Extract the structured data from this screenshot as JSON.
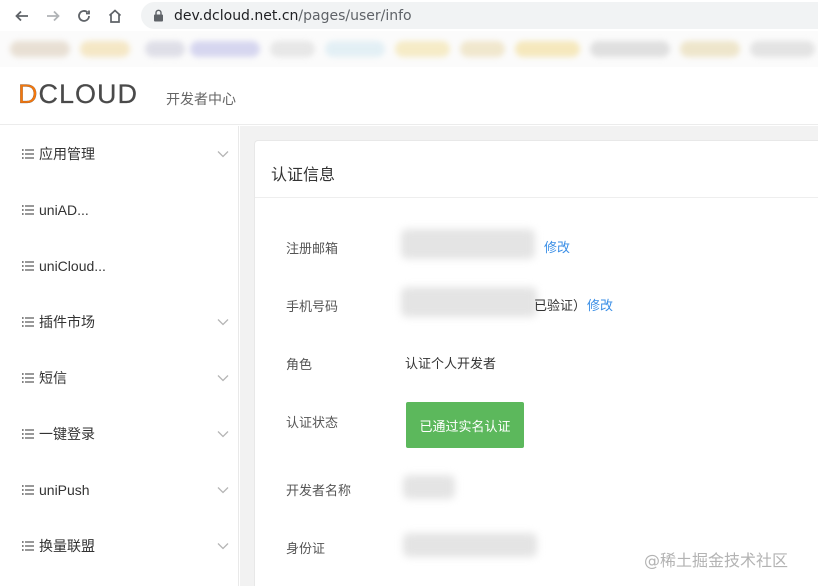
{
  "browser": {
    "url_host": "dev.dcloud.net.cn",
    "url_path": "/pages/user/info"
  },
  "header": {
    "logo_first": "D",
    "logo_rest": "CLOUD",
    "subtitle": "开发者中心"
  },
  "sidebar": {
    "items": [
      {
        "label": "应用管理",
        "has_chevron": true
      },
      {
        "label": "uniAD...",
        "has_chevron": false
      },
      {
        "label": "uniCloud...",
        "has_chevron": false
      },
      {
        "label": "插件市场",
        "has_chevron": true
      },
      {
        "label": "短信",
        "has_chevron": true
      },
      {
        "label": "一键登录",
        "has_chevron": true
      },
      {
        "label": "uniPush",
        "has_chevron": true
      },
      {
        "label": "换量联盟",
        "has_chevron": true
      }
    ]
  },
  "card": {
    "title": "认证信息",
    "email_label": "注册邮箱",
    "email_edit": "修改",
    "phone_label": "手机号码",
    "phone_suffix": "已验证）",
    "phone_edit": "修改",
    "role_label": "角色",
    "role_value": "认证个人开发者",
    "status_label": "认证状态",
    "status_value": "已通过实名认证",
    "dev_name_label": "开发者名称",
    "id_label": "身份证"
  },
  "colors": {
    "accent_link": "#3a8ee6",
    "status_green": "#5cb85c",
    "logo_orange": "#f4770c"
  },
  "watermark": "@稀土掘金技术社区"
}
